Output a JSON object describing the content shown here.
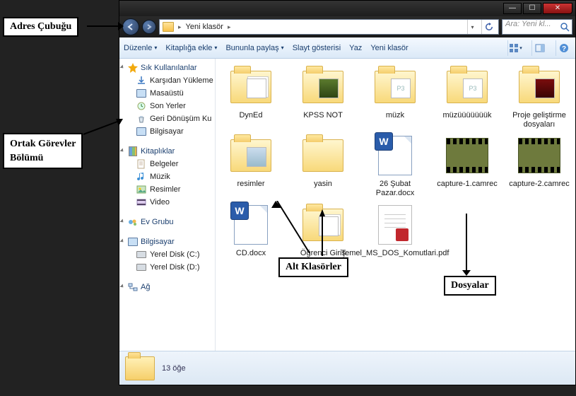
{
  "annotations": {
    "address_bar_label": "Adres Çubuğu",
    "tasks_panel_label_line1": "Ortak Görevler",
    "tasks_panel_label_line2": "Bölümü",
    "subfolders_label": "Alt Klasörler",
    "files_label": "Dosyalar"
  },
  "window": {
    "min": "—",
    "max": "☐",
    "close": "✕"
  },
  "address": {
    "folder_name": "Yeni klasör",
    "chevron": "▸",
    "chevron2": "▸"
  },
  "search": {
    "placeholder": "Ara: Yeni kl..."
  },
  "toolbar": {
    "organize": "Düzenle",
    "add_to_library": "Kitaplığa ekle",
    "share_with": "Bununla paylaş",
    "slideshow": "Slayt gösterisi",
    "print": "Yaz",
    "new_folder": "Yeni klasör",
    "dd": "▾"
  },
  "sidebar": {
    "favorites": {
      "header": "Sık Kullanılanlar",
      "items": [
        {
          "label": "Karşıdan Yükleme"
        },
        {
          "label": "Masaüstü"
        },
        {
          "label": "Son Yerler"
        },
        {
          "label": "Geri Dönüşüm Ku"
        },
        {
          "label": "Bilgisayar"
        }
      ]
    },
    "libraries": {
      "header": "Kitaplıklar",
      "items": [
        {
          "label": "Belgeler"
        },
        {
          "label": "Müzik"
        },
        {
          "label": "Resimler"
        },
        {
          "label": "Video"
        }
      ]
    },
    "homegroup": {
      "header": "Ev Grubu"
    },
    "computer": {
      "header": "Bilgisayar",
      "items": [
        {
          "label": "Yerel Disk (C:)"
        },
        {
          "label": "Yerel Disk (D:)"
        }
      ]
    },
    "network": {
      "header": "Ağ"
    }
  },
  "items": [
    {
      "name": "DynEd",
      "type": "folder",
      "preview": "stack"
    },
    {
      "name": "KPSS NOT",
      "type": "folder",
      "preview": "green"
    },
    {
      "name": "müzk",
      "type": "folder",
      "preview": "mp3"
    },
    {
      "name": "müzüüüüüüük",
      "type": "folder",
      "preview": "mp3"
    },
    {
      "name": "Proje geliştirme dosyaları",
      "type": "folder",
      "preview": "red"
    },
    {
      "name": "resimler",
      "type": "folder",
      "preview": "photo"
    },
    {
      "name": "yasin",
      "type": "folder",
      "preview": ""
    },
    {
      "name": "26 Şubat Pazar.docx",
      "type": "word"
    },
    {
      "name": "capture-1.camrec",
      "type": "video"
    },
    {
      "name": "capture-2.camrec",
      "type": "video"
    },
    {
      "name": "CD.docx",
      "type": "word"
    },
    {
      "name": "Öğrenci Giriş",
      "type": "folder",
      "preview": "stack"
    },
    {
      "name": "Temel_MS_DOS_Komutlari.pdf",
      "type": "pdf"
    }
  ],
  "status": {
    "count_text": "13 öğe"
  }
}
